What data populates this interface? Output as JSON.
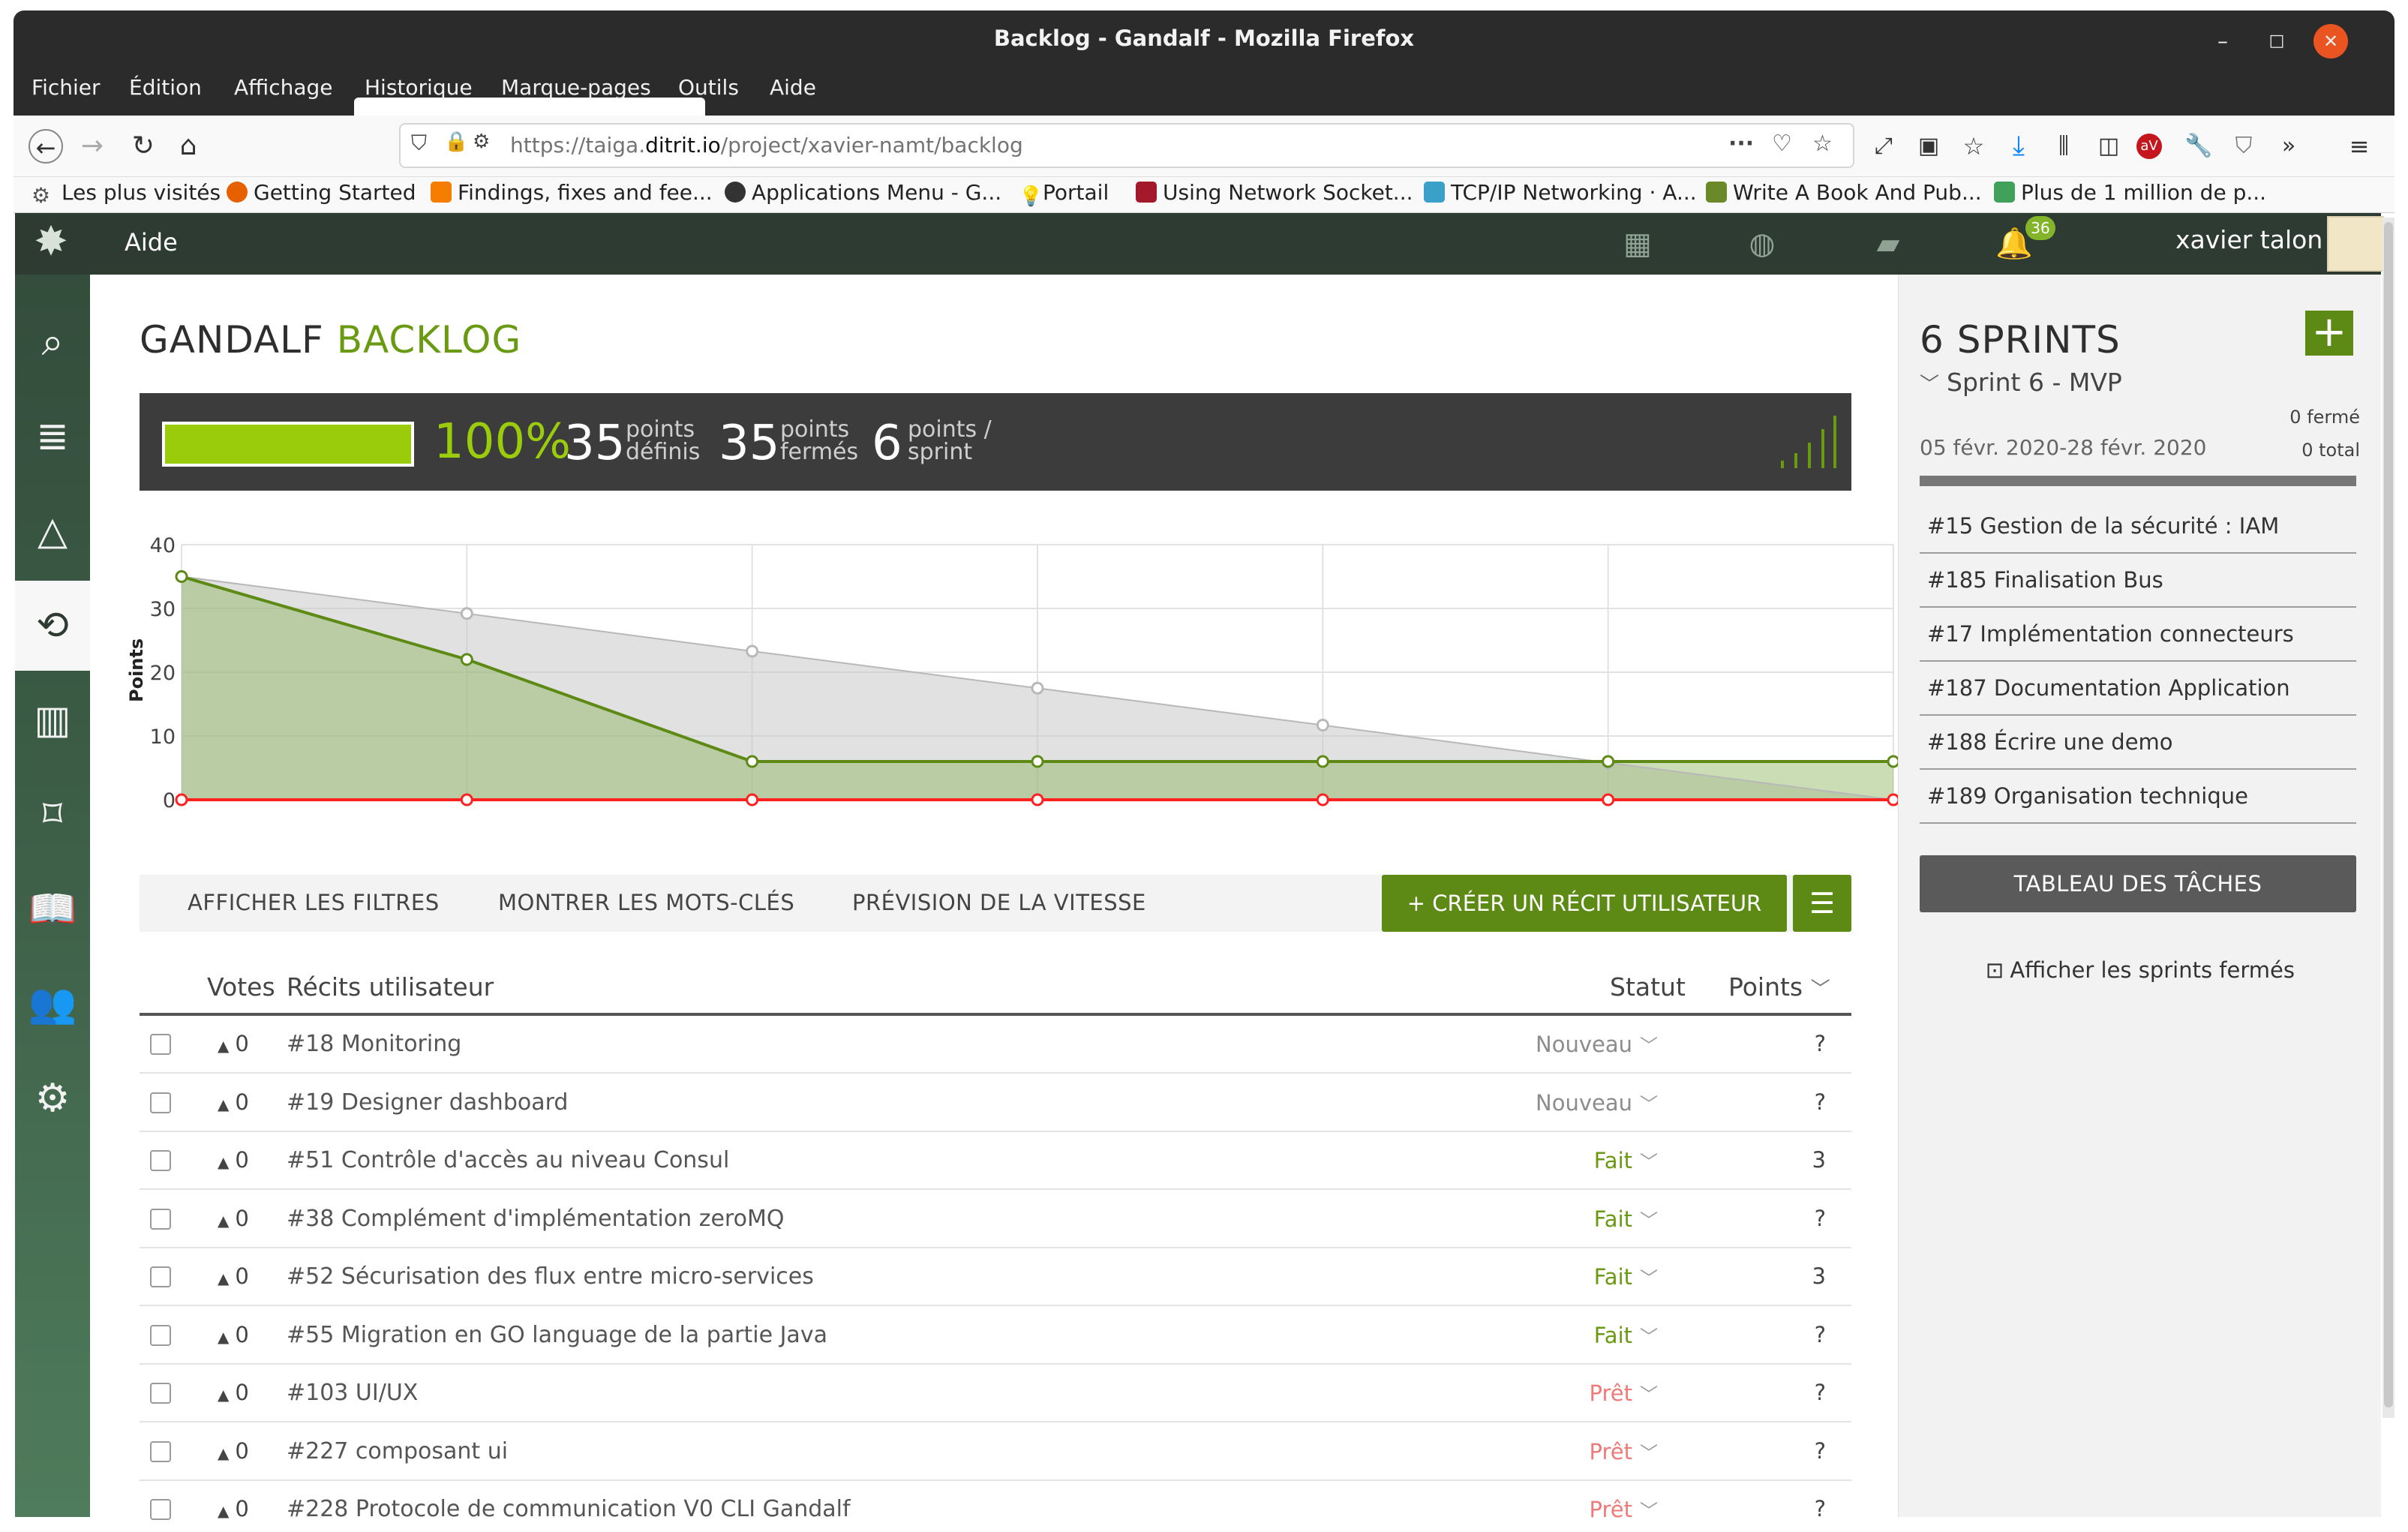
{
  "window": {
    "title": "Backlog - Gandalf - Mozilla Firefox",
    "controls": [
      "–",
      "□",
      "✕"
    ]
  },
  "menu": [
    "Fichier",
    "Édition",
    "Affichage",
    "Historique",
    "Marque-pages",
    "Outils",
    "Aide"
  ],
  "browser": {
    "url_prefix": "https://taiga.",
    "url_domain": "ditrit.io",
    "url_path": "/project/xavier-namt/backlog",
    "bookmarks": [
      {
        "label": "Les plus visités",
        "icon": "gear-icon",
        "color": "#555555"
      },
      {
        "label": "Getting Started",
        "icon": "firefox-icon",
        "color": "#e66000"
      },
      {
        "label": "Findings, fixes and fee...",
        "icon": "blogger-icon",
        "color": "#f57d00"
      },
      {
        "label": "Applications Menu - G...",
        "icon": "gnome-icon",
        "color": "#333333"
      },
      {
        "label": "Portail",
        "icon": "bulb-icon",
        "color": "#e0b000"
      },
      {
        "label": "Using Network Socket...",
        "icon": "book-icon",
        "color": "#a3192b"
      },
      {
        "label": "TCP/IP Networking · A...",
        "icon": "network-icon",
        "color": "#3aa0c8"
      },
      {
        "label": "Write A Book And Pub...",
        "icon": "leaf-icon",
        "color": "#6a8a2a"
      },
      {
        "label": "Plus de 1 million de p...",
        "icon": "px-icon",
        "color": "#41a05a"
      }
    ]
  },
  "taiga": {
    "help": "Aide",
    "notifications": "36",
    "user": "xavier talon"
  },
  "page": {
    "title_project": "GANDALF",
    "title_section": "BACKLOG"
  },
  "summary": {
    "progress": 1.0,
    "percent": "100%",
    "defined_value": "35",
    "defined_label_1": "points",
    "defined_label_2": "définis",
    "closed_value": "35",
    "closed_label_1": "points",
    "closed_label_2": "fermés",
    "per_sprint_value": "6",
    "per_sprint_label_1": "points /",
    "per_sprint_label_2": "sprint"
  },
  "chart_data": {
    "type": "area",
    "ylabel": "Points",
    "ylim": [
      0,
      40
    ],
    "yticks": [
      0,
      10,
      20,
      30,
      40
    ],
    "x": [
      0,
      1,
      2,
      3,
      4,
      5,
      6
    ],
    "series": [
      {
        "name": "",
        "color": "#b8b8b8",
        "values": [
          35,
          29.2,
          23.3,
          17.5,
          11.7,
          5.8,
          0
        ]
      },
      {
        "name": "",
        "color": "#5c8a14",
        "values": [
          35,
          22,
          6,
          6,
          6,
          6,
          6
        ]
      },
      {
        "name": "",
        "color": "#ff2020",
        "values": [
          0,
          0,
          0,
          0,
          0,
          0,
          0
        ]
      }
    ]
  },
  "toolbar": {
    "filters": "AFFICHER LES FILTRES",
    "tags": "MONTRER LES MOTS-CLÉS",
    "velocity": "PRÉVISION DE LA VITESSE",
    "create": "+ CRÉER UN RÉCIT UTILISATEUR"
  },
  "table": {
    "col_votes": "Votes",
    "col_stories": "Récits utilisateur",
    "col_status": "Statut",
    "col_points": "Points",
    "rows": [
      {
        "votes": "0",
        "title": "#18 Monitoring",
        "status": "Nouveau",
        "status_color": "#8c8c8c",
        "points": "?"
      },
      {
        "votes": "0",
        "title": "#19 Designer dashboard",
        "status": "Nouveau",
        "status_color": "#8c8c8c",
        "points": "?"
      },
      {
        "votes": "0",
        "title": "#51 Contrôle d'accès au niveau Consul",
        "status": "Fait",
        "status_color": "#6a9a12",
        "points": "3"
      },
      {
        "votes": "0",
        "title": "#38 Complément d'implémentation zeroMQ",
        "status": "Fait",
        "status_color": "#6a9a12",
        "points": "?"
      },
      {
        "votes": "0",
        "title": "#52 Sécurisation des flux entre micro-services",
        "status": "Fait",
        "status_color": "#6a9a12",
        "points": "3"
      },
      {
        "votes": "0",
        "title": "#55 Migration en GO language de la partie Java",
        "status": "Fait",
        "status_color": "#6a9a12",
        "points": "?"
      },
      {
        "votes": "0",
        "title": "#103 UI/UX",
        "status": "Prêt",
        "status_color": "#f07a7a",
        "points": "?"
      },
      {
        "votes": "0",
        "title": "#227 composant ui",
        "status": "Prêt",
        "status_color": "#f07a7a",
        "points": "?"
      },
      {
        "votes": "0",
        "title": "#228 Protocole de communication V0 CLI Gandalf",
        "status": "Prêt",
        "status_color": "#f07a7a",
        "points": "?"
      }
    ]
  },
  "sprints": {
    "title": "6 SPRINTS",
    "current_name": "Sprint 6 - MVP",
    "closed": "0 fermé",
    "dates": "05 févr. 2020-28 févr. 2020",
    "total": "0 total",
    "items": [
      "#15 Gestion de la sécurité : IAM",
      "#185 Finalisation Bus",
      "#17 Implémentation connecteurs",
      "#187 Documentation Application",
      "#188 Écrire une demo",
      "#189 Organisation technique"
    ],
    "board": "TABLEAU DES TÂCHES",
    "show_closed": "Afficher les sprints fermés"
  }
}
